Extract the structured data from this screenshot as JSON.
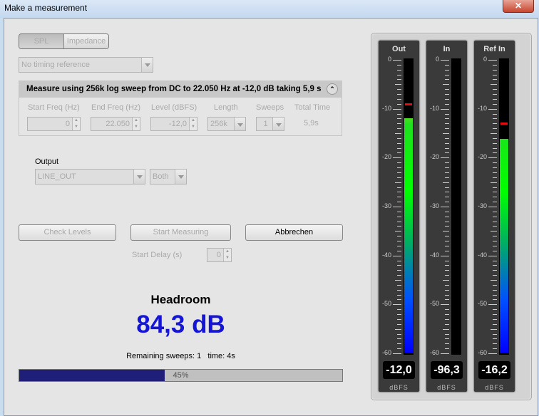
{
  "window": {
    "title": "Make a measurement",
    "close": "✕"
  },
  "mode": {
    "options": [
      "SPL",
      "Impedance"
    ],
    "selected": "SPL"
  },
  "timing_reference": {
    "value": "No timing reference"
  },
  "measure": {
    "summary_label": "Measure using  256k log sweep from DC to 22.050 Hz at -12,0 dB taking 5,9 s",
    "collapse_icon": "⌃",
    "start_freq": {
      "label": "Start Freq (Hz)",
      "value": "0"
    },
    "end_freq": {
      "label": "End Freq (Hz)",
      "value": "22.050"
    },
    "level": {
      "label": "Level (dBFS)",
      "value": "-12,0"
    },
    "length": {
      "label": "Length",
      "value": "256k"
    },
    "sweeps": {
      "label": "Sweeps",
      "value": "1"
    },
    "total_time": {
      "label": "Total Time",
      "value": "5,9s"
    }
  },
  "output": {
    "label": "Output",
    "device": "LINE_OUT",
    "channel": "Both"
  },
  "buttons": {
    "check_levels": "Check Levels",
    "start_measuring": "Start Measuring",
    "cancel": "Abbrechen"
  },
  "start_delay": {
    "label": "Start Delay (s)",
    "value": "0"
  },
  "headroom": {
    "label": "Headroom",
    "value": "84,3 dB"
  },
  "status": {
    "remaining": "Remaining sweeps: 1   time: 4s"
  },
  "progress": {
    "percent": 45,
    "label": "45%"
  },
  "meters": [
    {
      "title": "Out",
      "level": -12.0,
      "peak": -9.0,
      "readout": "-12,0",
      "unit": "dBFS"
    },
    {
      "title": "In",
      "level": -96.3,
      "peak": null,
      "readout": "-96,3",
      "unit": "dBFS"
    },
    {
      "title": "Ref In",
      "level": -16.2,
      "peak": -13.0,
      "readout": "-16,2",
      "unit": "dBFS"
    }
  ],
  "meter_scale": {
    "labels": [
      "0",
      "-10",
      "-20",
      "-30",
      "-40",
      "-50",
      "-60"
    ],
    "min": -60,
    "max": 0
  }
}
